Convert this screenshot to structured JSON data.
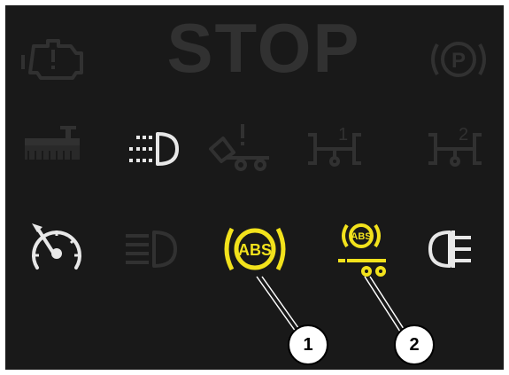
{
  "colors": {
    "panel_bg": "#191919",
    "inactive": "#313131",
    "active_yellow": "#f2e21c",
    "white_lamp": "#e8e8e8"
  },
  "panel": {
    "stop_label": "STOP",
    "lamps": [
      {
        "name": "engine-warning-icon",
        "state": "inactive"
      },
      {
        "name": "stop-indicator",
        "state": "inactive"
      },
      {
        "name": "parking-brake-icon",
        "state": "inactive",
        "text": "P"
      },
      {
        "name": "implement-control-icon",
        "state": "inactive"
      },
      {
        "name": "low-beam-icon",
        "state": "active",
        "color": "white"
      },
      {
        "name": "trailer-tip-warning-icon",
        "state": "inactive"
      },
      {
        "name": "front-axle-1-icon",
        "state": "inactive",
        "text": "1"
      },
      {
        "name": "front-axle-2-icon",
        "state": "inactive",
        "text": "2"
      },
      {
        "name": "speedometer-icon",
        "state": "active",
        "color": "white"
      },
      {
        "name": "high-beam-icon",
        "state": "inactive"
      },
      {
        "name": "abs-tractor-icon",
        "state": "active",
        "color": "yellow",
        "text": "ABS"
      },
      {
        "name": "abs-trailer-icon",
        "state": "active",
        "color": "yellow",
        "text": "ABS"
      },
      {
        "name": "rear-fog-light-icon",
        "state": "active",
        "color": "white"
      }
    ]
  },
  "callouts": [
    {
      "label": "1"
    },
    {
      "label": "2"
    }
  ]
}
